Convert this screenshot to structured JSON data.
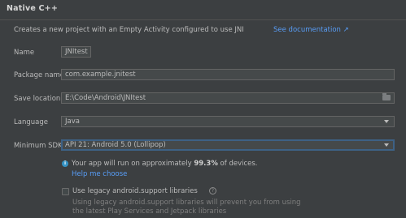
{
  "header": {
    "title": "Native C++"
  },
  "description": "Creates a new project with an Empty Activity configured to use JNI",
  "doc_link": "See documentation ↗",
  "form": {
    "name_label": "Name",
    "name_value": "JNItest",
    "package_label": "Package name",
    "package_value": "com.example.jnitest",
    "save_label": "Save location",
    "save_value": "E:\\Code\\Android\\JNItest",
    "language_label": "Language",
    "language_value": "Java",
    "sdk_label": "Minimum SDK",
    "sdk_value": "API 21: Android 5.0 (Lollipop)"
  },
  "info": {
    "prefix": "Your app will run on approximately ",
    "percent": "99.3%",
    "suffix": " of devices.",
    "help_link": "Help me choose"
  },
  "legacy": {
    "label": "Use legacy android.support libraries",
    "help_icon": "?",
    "hint_line1": "Using legacy android.support libraries will prevent you from using",
    "hint_line2": "the latest Play Services and Jetpack libraries"
  },
  "colors": {
    "background": "#3c3f41",
    "link": "#589df6",
    "field_bg": "#45494a",
    "focus_border": "#3d6185",
    "info_icon": "#3592c4"
  }
}
